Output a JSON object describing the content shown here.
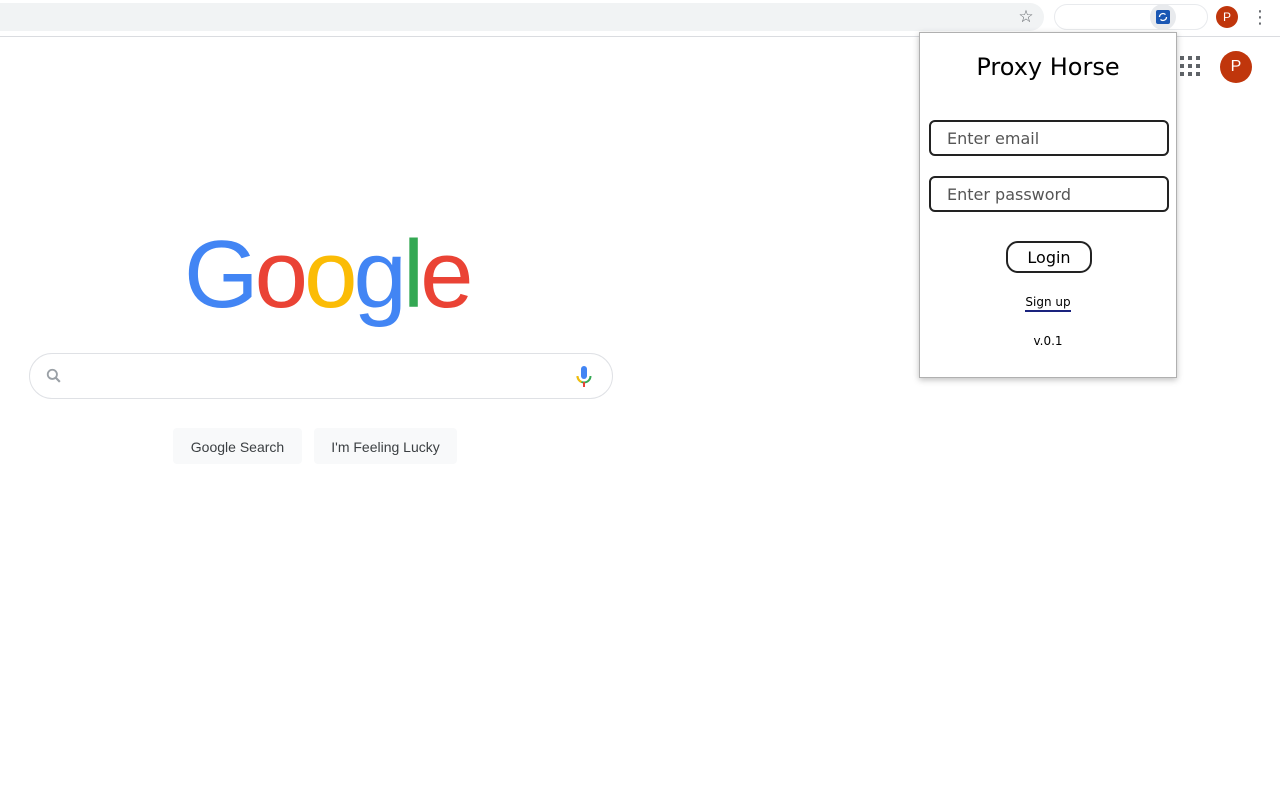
{
  "browser": {
    "profile_initial": "P",
    "icons": {
      "bookmark": "star-icon",
      "extension": "proxy-horse-extension-icon",
      "menu": "kebab-menu-icon"
    }
  },
  "google": {
    "logo_letters": [
      "G",
      "o",
      "o",
      "g",
      "l",
      "e"
    ],
    "logo_colors": [
      "#4285F4",
      "#EA4335",
      "#FBBC05",
      "#4285F4",
      "#34A853",
      "#EA4335"
    ],
    "search": {
      "value": "",
      "placeholder": ""
    },
    "buttons": {
      "search": "Google Search",
      "lucky": "I'm Feeling Lucky"
    },
    "avatar_initial": "P",
    "avatar_color": "#C0360C",
    "icons": {
      "apps": "apps-grid-icon",
      "search": "search-icon",
      "voice": "microphone-icon"
    }
  },
  "popup": {
    "title": "Proxy Horse",
    "email_placeholder": "Enter email",
    "password_placeholder": "Enter password",
    "login_label": "Login",
    "signup_label": "Sign up",
    "version": "v.0.1"
  }
}
